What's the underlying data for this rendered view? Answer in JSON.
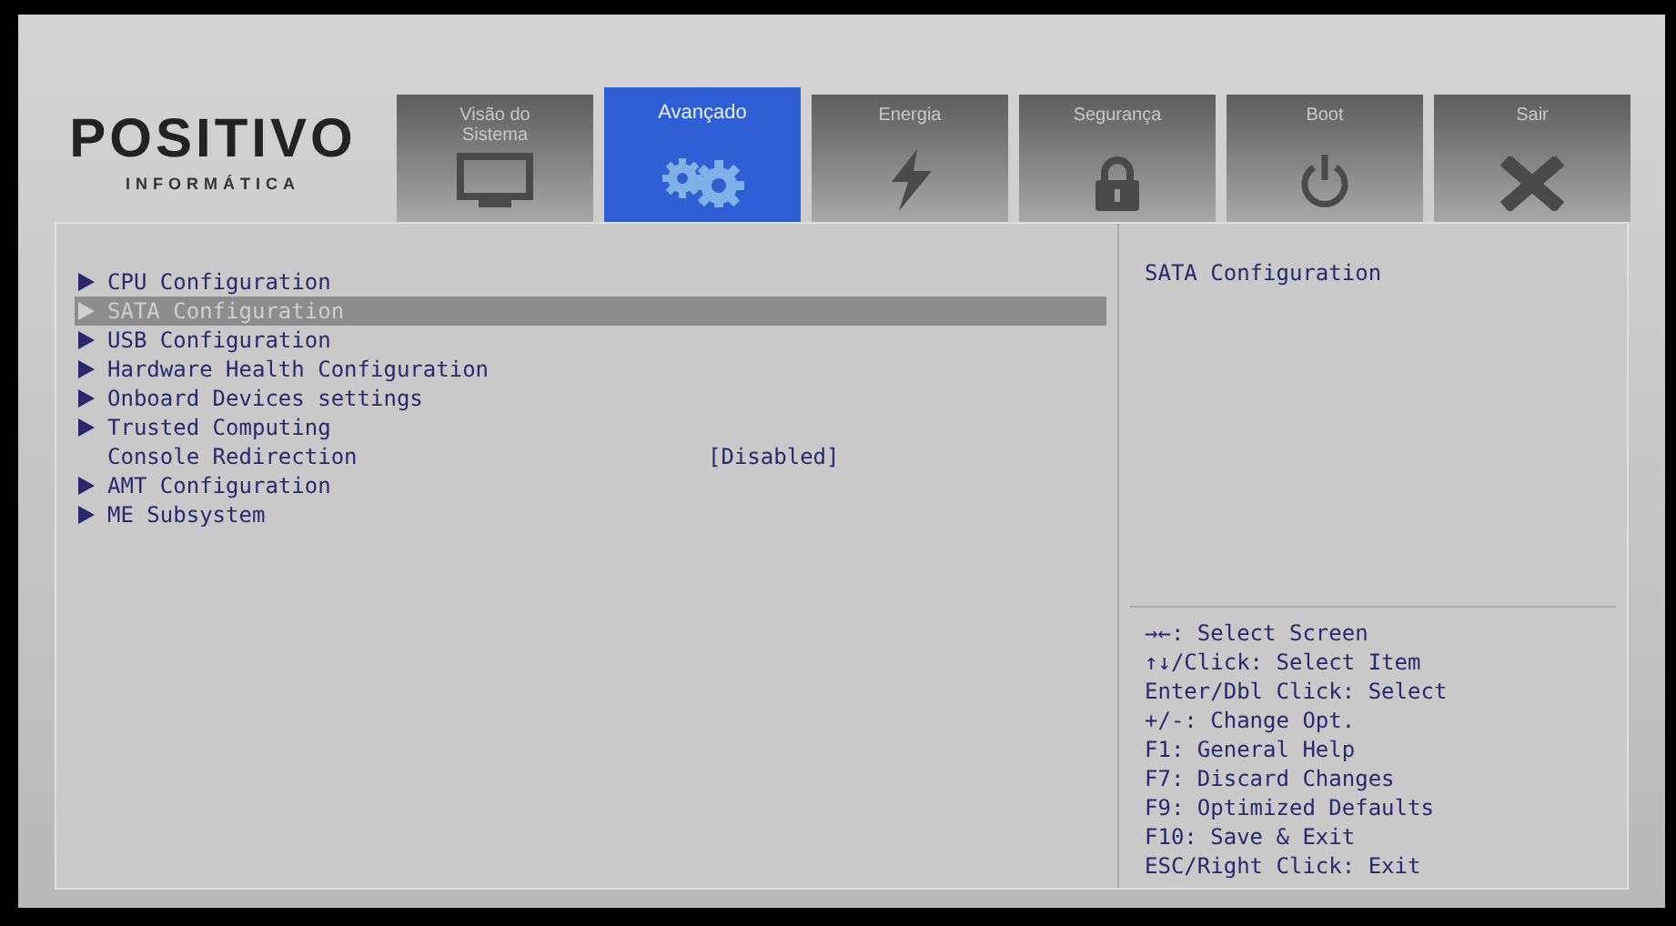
{
  "logo": {
    "name": "POSITIVO",
    "subtitle": "INFORMÁTICA"
  },
  "tabs": [
    {
      "label": "Visão do Sistema",
      "selected": false
    },
    {
      "label": "Avançado",
      "selected": true
    },
    {
      "label": "Energia",
      "selected": false
    },
    {
      "label": "Segurança",
      "selected": false
    },
    {
      "label": "Boot",
      "selected": false
    },
    {
      "label": "Sair",
      "selected": false
    }
  ],
  "menu": [
    {
      "kind": "submenu",
      "label": "CPU Configuration",
      "selected": false
    },
    {
      "kind": "submenu",
      "label": "SATA Configuration",
      "selected": true
    },
    {
      "kind": "submenu",
      "label": "USB Configuration",
      "selected": false
    },
    {
      "kind": "submenu",
      "label": "Hardware Health Configuration",
      "selected": false
    },
    {
      "kind": "submenu",
      "label": "Onboard Devices settings",
      "selected": false
    },
    {
      "kind": "submenu",
      "label": "Trusted Computing",
      "selected": false
    },
    {
      "kind": "setting",
      "label": "Console Redirection",
      "value": "[Disabled]",
      "selected": false
    },
    {
      "kind": "submenu",
      "label": "AMT Configuration",
      "selected": false
    },
    {
      "kind": "submenu",
      "label": "ME Subsystem",
      "selected": false
    }
  ],
  "help_text": "SATA Configuration",
  "key_help": [
    "→←: Select Screen",
    "↑↓/Click: Select Item",
    "Enter/Dbl Click: Select",
    "+/-: Change Opt.",
    "F1: General Help",
    "F7: Discard Changes",
    "F9: Optimized Defaults",
    "F10: Save & Exit",
    "ESC/Right Click: Exit"
  ]
}
